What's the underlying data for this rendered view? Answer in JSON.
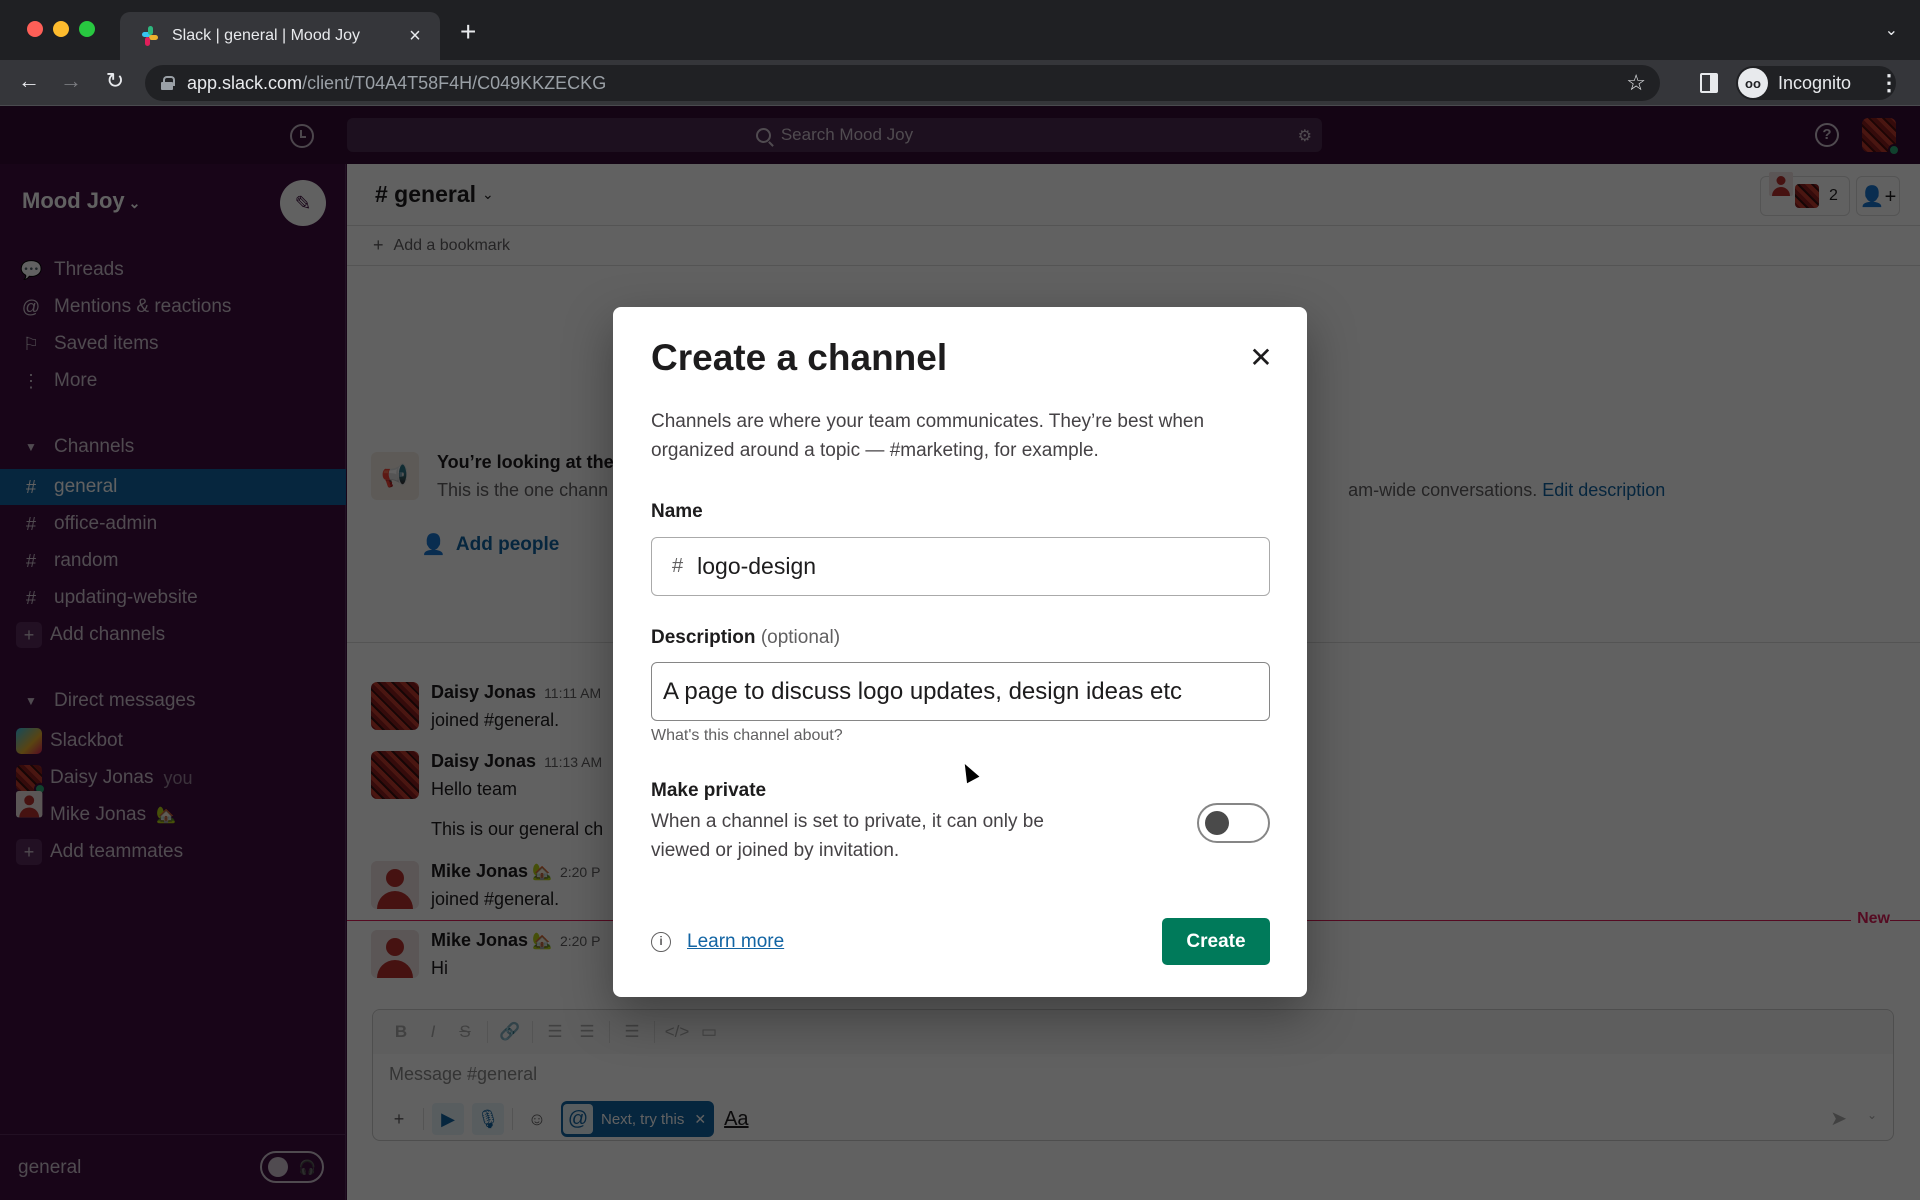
{
  "browser": {
    "tab_title": "Slack | general | Mood Joy",
    "url_host": "app.slack.com",
    "url_path": "/client/T04A4T58F4H/C049KKZECKG",
    "profile_label": "Incognito"
  },
  "topbar": {
    "search_placeholder": "Search Mood Joy"
  },
  "sidebar": {
    "workspace": "Mood Joy",
    "nav": [
      {
        "label": "Threads",
        "icon": "threads-icon"
      },
      {
        "label": "Mentions & reactions",
        "icon": "at-icon"
      },
      {
        "label": "Saved items",
        "icon": "bookmark-icon"
      },
      {
        "label": "More",
        "icon": "more-icon"
      }
    ],
    "channels_header": "Channels",
    "channels": [
      "general",
      "office-admin",
      "random",
      "updating-website"
    ],
    "selected_channel": "general",
    "add_channels": "Add channels",
    "dm_header": "Direct messages",
    "dms": [
      {
        "name": "Slackbot",
        "suffix": ""
      },
      {
        "name": "Daisy Jonas",
        "suffix": "you"
      },
      {
        "name": "Mike Jonas",
        "suffix": "🏡"
      }
    ],
    "add_teammates": "Add teammates",
    "footer_channel": "general"
  },
  "channel": {
    "name": "# general",
    "member_count": "2",
    "add_bookmark": "Add a bookmark",
    "intro_title": "You’re looking at the",
    "intro_desc_start": "This is the one chann",
    "intro_desc_end": "am-wide conversations.",
    "edit_description": "Edit description",
    "add_people": "Add people"
  },
  "messages": [
    {
      "author": "Daisy Jonas",
      "emoji": "",
      "time": "11:11 AM",
      "text": "joined #general."
    },
    {
      "author": "Daisy Jonas",
      "emoji": "",
      "time": "11:13 AM",
      "text": "Hello team",
      "extra": "This is our general ch"
    },
    {
      "author": "Mike Jonas",
      "emoji": "🏡",
      "time": "2:20 P",
      "text": "joined #general."
    },
    {
      "author": "Mike Jonas",
      "emoji": "🏡",
      "time": "2:20 P",
      "text": "Hi"
    }
  ],
  "new_divider_label": "New",
  "composer": {
    "placeholder": "Message #general",
    "try_chip": "Next, try this",
    "format_label": "Aa"
  },
  "modal": {
    "title": "Create a channel",
    "intro": "Channels are where your team communicates. They’re best when organized around a topic — #marketing, for example.",
    "name_label": "Name",
    "name_prefix": "#",
    "name_value": "logo-design",
    "desc_label": "Description",
    "desc_optional": "(optional)",
    "desc_value": "A page to discuss logo updates, design ideas etc",
    "desc_hint": "What's this channel about?",
    "private_label": "Make private",
    "private_desc": "When a channel is set to private, it can only be viewed or joined by invitation.",
    "private_on": false,
    "learn_more": "Learn more",
    "create_label": "Create"
  },
  "colors": {
    "aubergine": "#3f0e40",
    "selected": "#1164a3",
    "create_green": "#007a5a",
    "link_blue": "#1264a3",
    "new_red": "#e01e5a"
  }
}
